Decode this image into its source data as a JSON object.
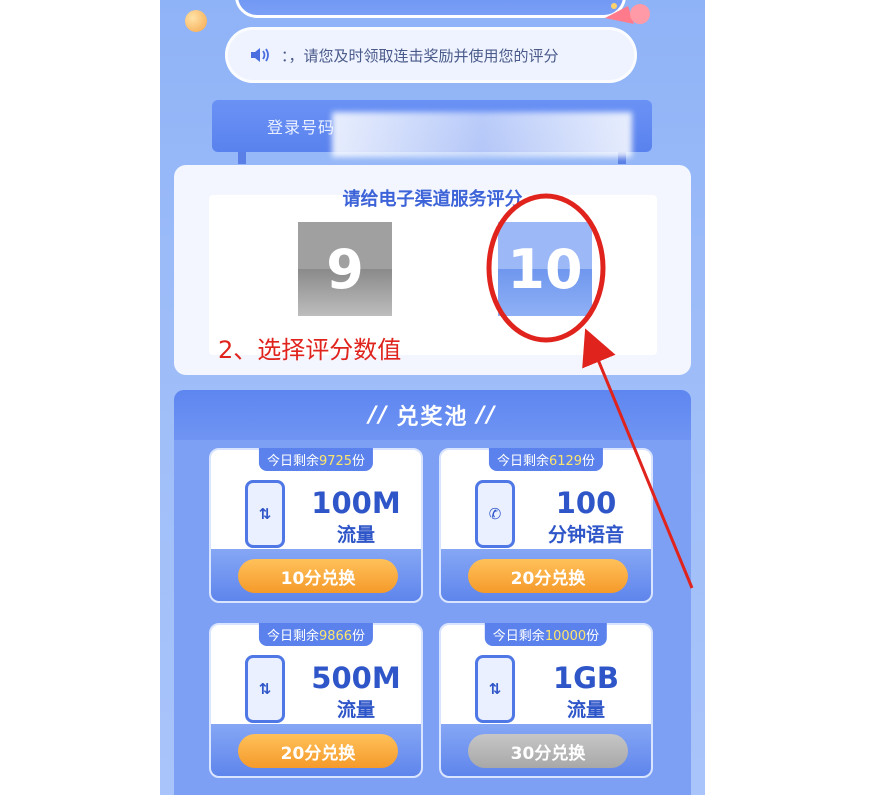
{
  "notice": {
    "icon": "speaker-icon",
    "text": "：，请您及时领取连击奖励并使用您的评分"
  },
  "login": {
    "label": "登录号码"
  },
  "rating": {
    "title": "请给电子渠道服务评分",
    "scores": [
      "9",
      "10"
    ],
    "selected": "10"
  },
  "annotation": {
    "instruction": "2、选择评分数值",
    "color": "#e0231c"
  },
  "pool": {
    "title": "兑奖池",
    "mark_left": "//",
    "mark_right": "//",
    "rewards": [
      {
        "stock_prefix": "今日剩余",
        "stock": "9725",
        "stock_suffix": "份",
        "icon_glyph": "⇅",
        "amount": "100M",
        "unit": "流量",
        "button": "10分兑换",
        "enabled": true
      },
      {
        "stock_prefix": "今日剩余",
        "stock": "6129",
        "stock_suffix": "份",
        "icon_glyph": "✆",
        "amount": "100",
        "unit": "分钟语音",
        "button": "20分兑换",
        "enabled": true
      },
      {
        "stock_prefix": "今日剩余",
        "stock": "9866",
        "stock_suffix": "份",
        "icon_glyph": "⇅",
        "amount": "500M",
        "unit": "流量",
        "button": "20分兑换",
        "enabled": true
      },
      {
        "stock_prefix": "今日剩余",
        "stock": "10000",
        "stock_suffix": "份",
        "icon_glyph": "⇅",
        "amount": "1GB",
        "unit": "流量",
        "button": "30分兑换",
        "enabled": false
      }
    ]
  }
}
